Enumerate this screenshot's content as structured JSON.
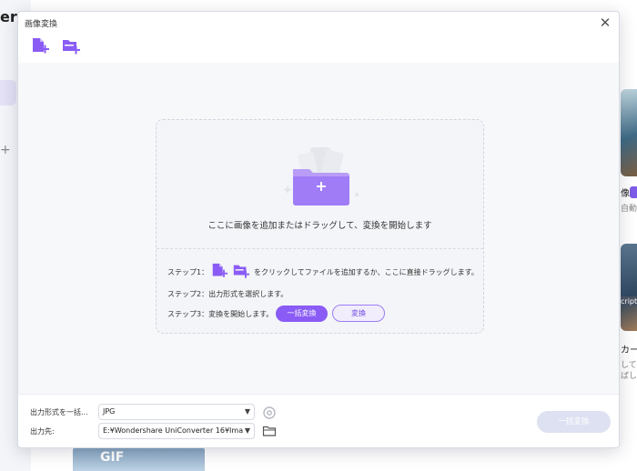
{
  "background": {
    "brand_fragment": "er",
    "card1_label": "像",
    "card1_sub": "自動",
    "card2_tag": "cript",
    "card2_label": "カー",
    "card2_sub": "して、",
    "card2_sub2": "ばし",
    "thumb_label": "GIF"
  },
  "dialog": {
    "title": "画像変換",
    "close_glyph": "✕"
  },
  "dropzone": {
    "main_text": "ここに画像を追加またはドラッグして、変換を開始します",
    "step1_label": "ステップ1：",
    "step1_text": "をクリックしてファイルを追加するか、ここに直接ドラッグします。",
    "step2_text": "ステップ2：出力形式を選択します。",
    "step3_label": "ステップ3：変換を開始します。",
    "batch_button": "一括変換",
    "convert_button": "変換"
  },
  "bottom": {
    "format_label": "出力形式を一括...",
    "format_value": "JPG",
    "output_label": "出力先:",
    "output_value": "E:¥Wondershare UniConverter 16¥Ima",
    "convert_all_button": "一括変換"
  },
  "colors": {
    "accent": "#8a5cf5",
    "accent_light": "#b99cf8",
    "disabled_button": "#dde1f1"
  }
}
